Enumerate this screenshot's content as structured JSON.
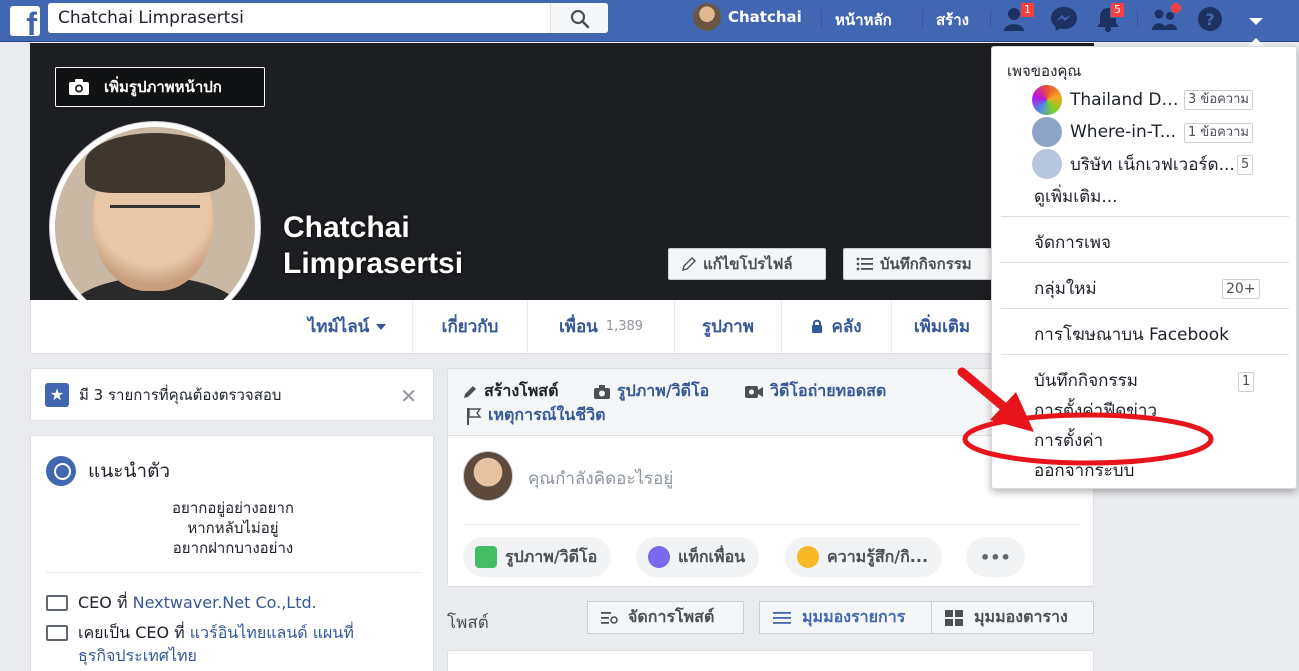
{
  "topbar": {
    "search_value": "Chatchai Limprasertsi",
    "user_name": "Chatchai",
    "home": "หน้าหลัก",
    "create": "สร้าง",
    "friend_requests_count": "1",
    "notifications_count": "5"
  },
  "cover": {
    "add_cover": "เพิ่มรูปภาพหน้าปก",
    "name_line1": "Chatchai",
    "name_line2": "Limprasertsi",
    "edit_profile": "แก้ไขโปรไฟล์",
    "activity_log": "บันทึกกิจกรรม"
  },
  "nav": {
    "timeline": "ไทม์ไลน์",
    "about": "เกี่ยวกับ",
    "friends": "เพื่อน",
    "friends_count": "1,389",
    "photos": "รูปภาพ",
    "archive": "คลัง",
    "more": "เพิ่มเติม"
  },
  "review": {
    "text": "มี 3 รายการที่คุณต้องตรวจสอบ"
  },
  "intro": {
    "title": "แนะนำตัว",
    "bio_lines": [
      "อยากอยู่อย่างอยาก",
      "หากหลับไม่อยู่",
      "อยากฝากบางอย่าง"
    ],
    "work1_prefix": "CEO ที่",
    "work1_link": "Nextwaver.Net Co.,Ltd.",
    "work2_prefix": "เคยเป็น CEO ที่",
    "work2_link_line1": "แวร์อินไทยแลนด์ แผนที่",
    "work2_link_line2": "ธุรกิจประเทศไทย"
  },
  "composer": {
    "create_post": "สร้างโพสต์",
    "photo_video": "รูปภาพ/วิดีโอ",
    "live_video": "วิดีโอถ่ายทอดสด",
    "life_event": "เหตุการณ์ในชีวิต",
    "placeholder": "คุณกำลังคิดอะไรอยู่",
    "pill_photo": "รูปภาพ/วิดีโอ",
    "pill_tag": "แท็กเพื่อน",
    "pill_feeling": "ความรู้สึก/กิ...",
    "pill_more": "•••"
  },
  "posts": {
    "label": "โพสต์",
    "manage": "จัดการโพสต์",
    "list_view": "มุมมองรายการ",
    "grid_view": "มุมมองตาราง"
  },
  "dropdown": {
    "header": "เพจของคุณ",
    "pages": [
      {
        "name": "Thailand De...",
        "count": "3 ข้อความ"
      },
      {
        "name": "Where-in-T...",
        "count": "1 ข้อความ"
      },
      {
        "name": "บริษัท เน็กเวฟเวอร์ด...",
        "count": "5"
      }
    ],
    "see_more": "ดูเพิ่มเติม...",
    "manage_pages": "จัดการเพจ",
    "new_groups": "กลุ่มใหม่",
    "new_groups_count": "20+",
    "advertise": "การโฆษณาบน Facebook",
    "activity_log": "บันทึกกิจกรรม",
    "activity_log_count": "1",
    "news_feed_prefs": "การตั้งค่าฟีดข่าว",
    "settings": "การตั้งค่า",
    "log_out": "ออกจากระบบ"
  },
  "colors": {
    "brand_blue": "#4267b2",
    "link_blue": "#365899",
    "badge_red": "#fa3e3e",
    "annotation_red": "#e8141c"
  }
}
